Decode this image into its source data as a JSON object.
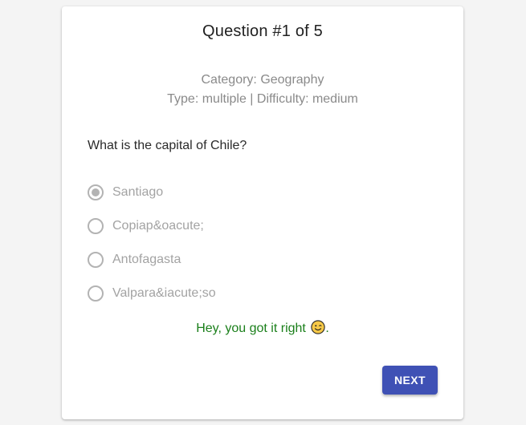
{
  "quiz": {
    "title": "Question #1 of 5",
    "category": "Category: Geography",
    "type_difficulty": "Type: multiple | Difficulty: medium",
    "question": "What is the capital of Chile?",
    "options": [
      {
        "label": "Santiago",
        "selected": true
      },
      {
        "label": "Copiap&oacute;",
        "selected": false
      },
      {
        "label": "Antofagasta",
        "selected": false
      },
      {
        "label": "Valpara&iacute;so",
        "selected": false
      }
    ],
    "feedback": {
      "text": "Hey, you got it right",
      "icon": "smiley-icon",
      "suffix": "."
    },
    "next_label": "NEXT"
  },
  "colors": {
    "accent": "#3f51b5",
    "success": "#1a7f1a",
    "muted_text": "#8a8a8a",
    "disabled": "#b3b3b3"
  }
}
